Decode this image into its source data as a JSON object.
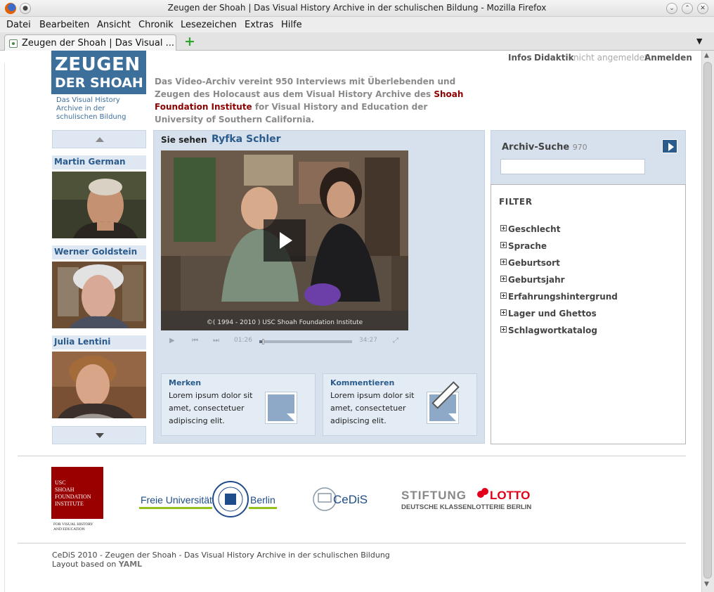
{
  "window": {
    "title": "Zeugen der Shoah | Das Visual History Archive in der schulischen Bildung - Mozilla Firefox"
  },
  "menubar": [
    "Datei",
    "Bearbeiten",
    "Ansicht",
    "Chronik",
    "Lesezeichen",
    "Extras",
    "Hilfe"
  ],
  "tab": {
    "label": "Zeugen der Shoah | Das Visual ..."
  },
  "toplinks": {
    "infos": "Infos",
    "didaktik": "Didaktik",
    "status": "nicht angemeldet",
    "login": "Anmelden"
  },
  "logo": {
    "line1": "ZEUGEN",
    "line2": "DER SHOAH",
    "sub": "Das Visual History Archive in der schulischen Bildung"
  },
  "intro": {
    "part1": "Das Video-Archiv vereint 950 Interviews mit Überlebenden und Zeugen des Holocaust aus dem Visual History Archive des ",
    "link": "Shoah Foundation Institute",
    "part2": " for Visual History and Education der University of Southern California."
  },
  "sidebar": {
    "persons": [
      {
        "name": "Martin German"
      },
      {
        "name": "Werner Goldstein"
      },
      {
        "name": "Julia Lentini"
      }
    ]
  },
  "player": {
    "label": "Sie sehen",
    "name": "Ryfka Schler",
    "copyright": "©( 1994 - 2010 ) USC Shoah Foundation Institute",
    "time_current": "01:26",
    "time_total": "34:27",
    "progress": 0.04
  },
  "merken": {
    "title": "Merken",
    "text": "Lorem ipsum dolor sit amet, consectetuer adipiscing elit."
  },
  "kommentieren": {
    "title": "Kommentieren",
    "text": "Lorem ipsum dolor sit amet, consectetuer adipiscing elit."
  },
  "search": {
    "title": "Archiv-Suche",
    "count": "970",
    "placeholder": ""
  },
  "filter": {
    "title": "FILTER",
    "items": [
      "Geschlecht",
      "Sprache",
      "Geburtsort",
      "Geburtsjahr",
      "Erfahrungshintergrund",
      "Lager und Ghettos",
      "Schlagwortkatalog"
    ]
  },
  "partners": {
    "usc": {
      "l1": "USC",
      "l2": "SHOAH",
      "l3": "FOUNDATION",
      "l4": "INSTITUTE",
      "l5": "FOR VISUAL HISTORY",
      "l6": "AND EDUCATION"
    },
    "fu": {
      "left": "Freie Universität",
      "right": "Berlin"
    },
    "cedis": "CeDiS",
    "lotto": {
      "l1": "STIFTUNG",
      "l2": "LOTTO",
      "l3": "DEUTSCHE KLASSENLOTTERIE BERLIN"
    }
  },
  "footer": {
    "line1": "CeDiS 2010 - Zeugen der Shoah - Das Visual History Archive in der schulischen Bildung",
    "line2_prefix": "Layout based on ",
    "line2_link": "YAML"
  },
  "colors": {
    "accent_blue": "#2a5b8c",
    "logo_blue": "#3d6f9b",
    "panel_blue": "#d6e1ed",
    "link_red": "#8b0000",
    "usc_red": "#990000",
    "lotto_red": "#e2001a",
    "fu_green": "#95c11f"
  }
}
